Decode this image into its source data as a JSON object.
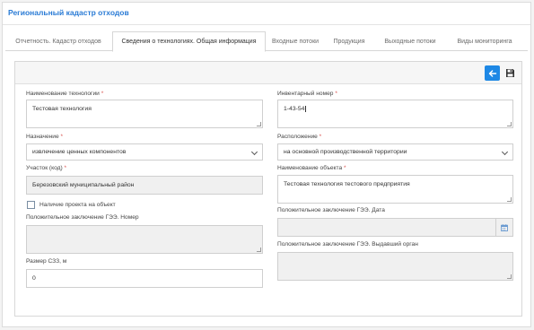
{
  "app": {
    "title": "Региональный кадастр отходов"
  },
  "tabs": [
    {
      "label": "Отчетность. Кадастр отходов"
    },
    {
      "label": "Сведения о технологиях. Общая информация"
    },
    {
      "label": "Входные потоки"
    },
    {
      "label": "Продукция"
    },
    {
      "label": "Выходные потоки"
    },
    {
      "label": "Виды мониторинга"
    }
  ],
  "form": {
    "name": {
      "label": "Наименование технологии",
      "value": "Тестовая технология"
    },
    "inventory": {
      "label": "Инвентарный номер",
      "value": "1-43-54"
    },
    "purpose": {
      "label": "Назначение",
      "value": "извлечение ценных компонентов"
    },
    "location": {
      "label": "Расположение",
      "value": "на основной производственной территории"
    },
    "district": {
      "label": "Участок (код)",
      "value": "Березовский муниципальный район"
    },
    "object_name": {
      "label": "Наименование объекта",
      "value": "Тестовая технология тестового предприятия"
    },
    "project": {
      "label": "Наличие проекта на объект"
    },
    "gee_number": {
      "label": "Положительное заключение ГЭЭ. Номер",
      "value": ""
    },
    "gee_date": {
      "label": "Положительное заключение ГЭЭ. Дата",
      "value": ""
    },
    "gee_org": {
      "label": "Положительное заключение ГЭЭ. Выдавший орган",
      "value": ""
    },
    "szz": {
      "label": "Размер СЗЗ, м",
      "value": "0"
    },
    "required_mark": "*"
  },
  "colors": {
    "accent": "#1e88e5",
    "title": "#2a7bd5",
    "required": "#d9534f"
  },
  "icons": {
    "back": "arrow-left-icon",
    "save": "floppy-disk-icon",
    "calendar": "calendar-icon",
    "chevron": "chevron-down-icon"
  }
}
